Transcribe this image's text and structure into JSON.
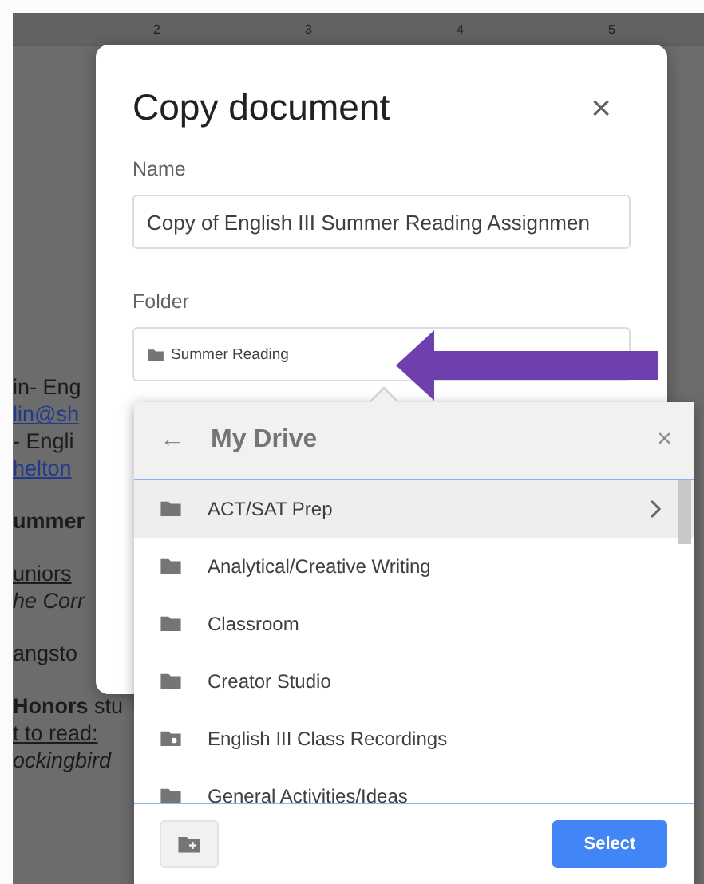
{
  "ruler": {
    "marks": [
      "2",
      "3",
      "4",
      "5"
    ]
  },
  "document": {
    "paragraphs": [
      [
        {
          "text": "in- Eng",
          "kind": "plain"
        },
        {
          "text": "lin@sh",
          "kind": "link"
        },
        {
          "text": "- Engli",
          "kind": "plain"
        },
        {
          "text": "helton",
          "kind": "link"
        }
      ],
      [
        {
          "text": "ummer",
          "kind": "bold"
        }
      ],
      [
        {
          "text": "uniors",
          "kind": "underline"
        },
        {
          "text": "he Corr",
          "kind": "italic"
        }
      ],
      [
        {
          "text": "angsto",
          "kind": "plain"
        }
      ],
      [
        {
          "text": "**Honors** stu",
          "kind": "plain"
        },
        {
          "text": "t to read:",
          "kind": "underline"
        },
        {
          "text": "ockingbird",
          "kind": "italic"
        }
      ]
    ]
  },
  "dialog": {
    "title": "Copy document",
    "close": "×",
    "name_label": "Name",
    "name_value": "Copy of English III Summer Reading Assignmen",
    "folder_label": "Folder",
    "folder_value": "Summer Reading"
  },
  "picker": {
    "back": "←",
    "title": "My Drive",
    "close": "×",
    "items": [
      {
        "label": "ACT/SAT Prep",
        "kind": "folder",
        "selected": true
      },
      {
        "label": "Analytical/Creative Writing",
        "kind": "folder",
        "selected": false
      },
      {
        "label": "Classroom",
        "kind": "folder",
        "selected": false
      },
      {
        "label": "Creator Studio",
        "kind": "folder",
        "selected": false
      },
      {
        "label": "English III Class Recordings",
        "kind": "shared",
        "selected": false
      },
      {
        "label": "General Activities/Ideas",
        "kind": "folder",
        "selected": false
      }
    ],
    "select_button": "Select"
  }
}
